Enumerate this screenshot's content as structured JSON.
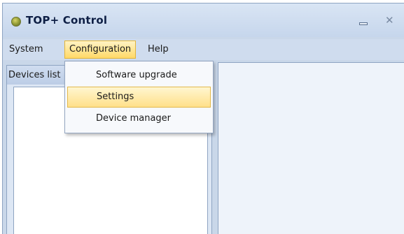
{
  "window": {
    "title": "TOP+ Control",
    "icons": {
      "app": "app-circle-icon",
      "minimize": "minimize-icon",
      "close": "close-icon"
    },
    "close_glyph": "✕"
  },
  "menubar": {
    "items": [
      {
        "label": "System"
      },
      {
        "label": "Configuration",
        "state": "open"
      },
      {
        "label": "Help"
      }
    ]
  },
  "configuration_menu": {
    "items": [
      {
        "label": "Software upgrade"
      },
      {
        "label": "Settings",
        "state": "highlighted"
      },
      {
        "label": "Device manager"
      }
    ]
  },
  "left_panel": {
    "header": "Devices list"
  },
  "colors": {
    "menu_highlight": "#ffd968",
    "menu_highlight_border": "#e3b437",
    "window_bg": "#c9d7e9",
    "title_text": "#0e1f45"
  }
}
